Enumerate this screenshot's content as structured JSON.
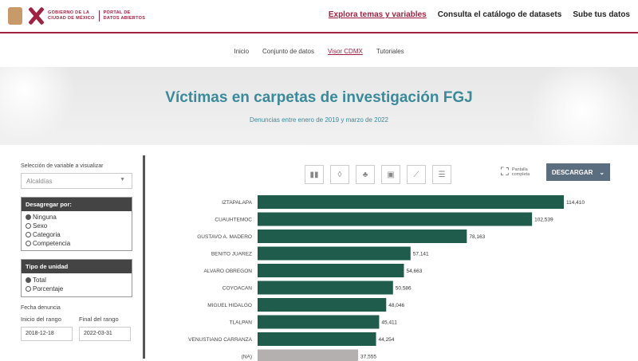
{
  "header": {
    "gov_line1": "GOBIERNO DE LA",
    "gov_line2": "CIUDAD DE MÉXICO",
    "portal_line1": "PORTAL DE",
    "portal_line2": "DATOS ABIERTOS",
    "nav": [
      {
        "label": "Explora temas y variables"
      },
      {
        "label": "Consulta el catálogo de datasets"
      },
      {
        "label": "Sube tus datos"
      }
    ]
  },
  "subnav": [
    {
      "label": "Inicio"
    },
    {
      "label": "Conjunto de datos"
    },
    {
      "label": "Visor CDMX"
    },
    {
      "label": "Tutoriales"
    }
  ],
  "hero": {
    "title": "Víctimas en carpetas de investigación FGJ",
    "subtitle": "Denuncias entre enero de 2019 y marzo de 2022"
  },
  "sidebar": {
    "variable_label": "Selección de variable a visualizar",
    "variable_value": "Alcaldías",
    "disaggregate": {
      "title": "Desagregar por:",
      "options": [
        "Ninguna",
        "Sexo",
        "Categoria",
        "Competencia"
      ]
    },
    "unit": {
      "title": "Tipo de unidad",
      "options": [
        "Total",
        "Porcentaje"
      ]
    },
    "date_title": "Fecha denuncia",
    "start_label": "Inicio del rango",
    "start_value": "2018-12-18",
    "end_label": "Final del rango",
    "end_value": "2022-03-31"
  },
  "toolbar": {
    "fullscreen_line1": "Pantalla",
    "fullscreen_line2": "completa",
    "download": "DESCARGAR"
  },
  "colors": {
    "accent": "#9f2241",
    "bar": "#1f5c4b",
    "bar_na": "#b5b0b0",
    "title": "#3a8a9a"
  },
  "chart_data": {
    "type": "bar",
    "orientation": "horizontal",
    "categories": [
      "IZTAPALAPA",
      "CUAUHTEMOC",
      "GUSTAVO A. MADERO",
      "BENITO JUAREZ",
      "ALVARO OBREGON",
      "COYOACAN",
      "MIGUEL HIDALGO",
      "TLALPAN",
      "VENUSTIANO CARRANZA",
      "(NA)"
    ],
    "values": [
      114410,
      102539,
      78163,
      57141,
      54663,
      50586,
      48046,
      45411,
      44254,
      37555
    ],
    "value_labels": [
      "114,410",
      "102,539",
      "78,163",
      "57,141",
      "54,663",
      "50,586",
      "48,046",
      "45,411",
      "44,254",
      "37,555"
    ],
    "xlim": [
      0,
      114410
    ],
    "grid": false,
    "legend": "none"
  }
}
